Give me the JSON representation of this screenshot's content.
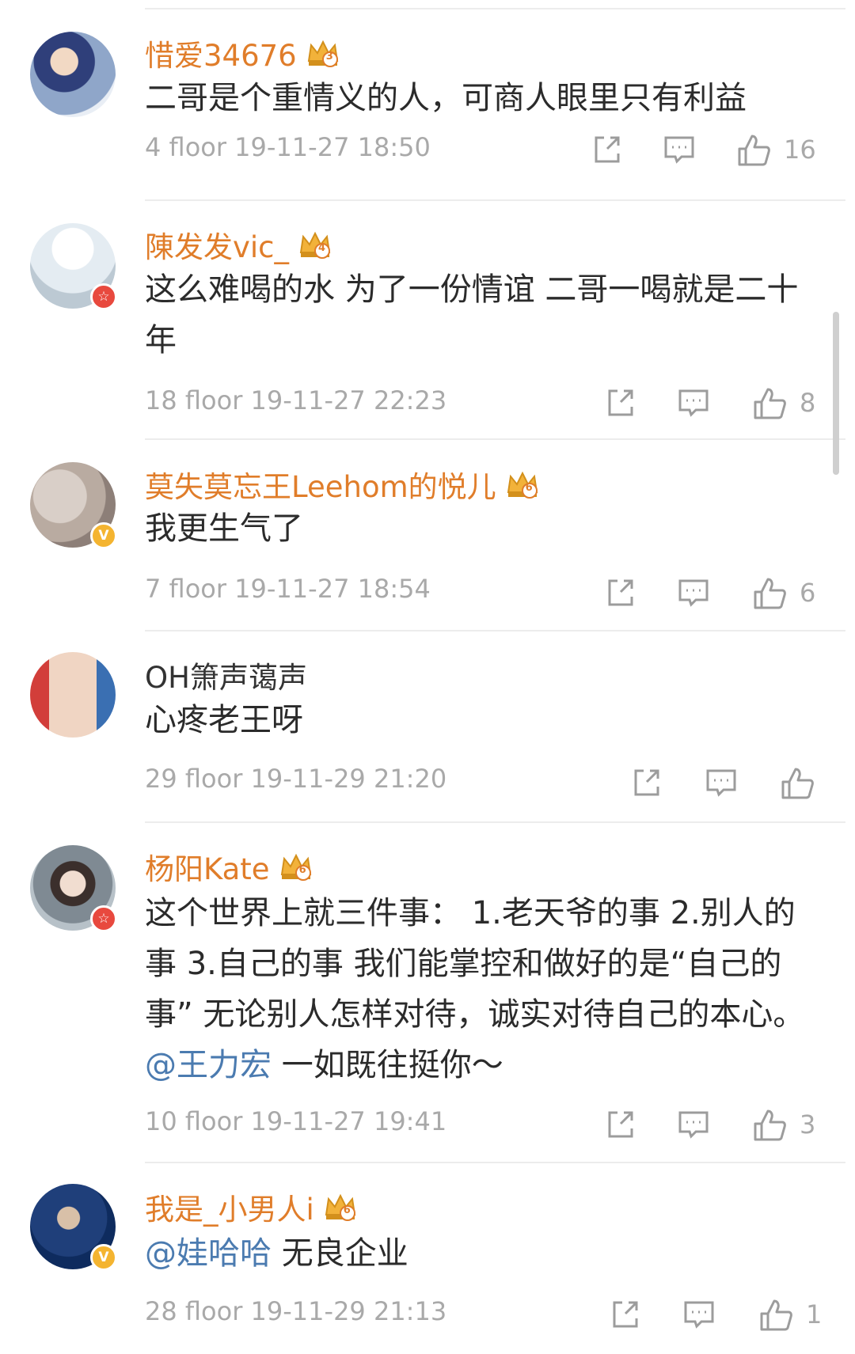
{
  "colors": {
    "username": "#e07d2a",
    "mention": "#4b7bb0",
    "meta": "#a9a9a9",
    "badge_red": "#e8493e",
    "badge_gold": "#f4b430"
  },
  "comments": [
    {
      "username": "惜爱34676",
      "crown_level": "3",
      "text": "二哥是个重情义的人，可商人眼里只有利益",
      "floor": "4 floor",
      "time": "19-11-27 18:50",
      "likes": "16",
      "badge": ""
    },
    {
      "username": "陳发发vic_",
      "crown_level": "4",
      "text": "这么难喝的水 为了一份情谊 二哥一喝就是二十年",
      "floor": "18 floor",
      "time": "19-11-27 22:23",
      "likes": "8",
      "badge": "red"
    },
    {
      "username": "莫失莫忘王Leehom的悦儿",
      "crown_level": "6",
      "text": "我更生气了",
      "floor": "7 floor",
      "time": "19-11-27 18:54",
      "likes": "6",
      "badge": "gold"
    },
    {
      "username": "OH箫声蔼声",
      "crown_level": "",
      "text": "心疼老王呀",
      "floor": "29 floor",
      "time": "19-11-29 21:20",
      "likes": "",
      "badge": ""
    },
    {
      "username": "杨阳Kate",
      "crown_level": "6",
      "text_before": "这个世界上就三件事： 1.老天爷的事 2.别人的事 3.自己的事 我们能掌控和做好的是“自己的事” 无论别人怎样对待，诚实对待自己的本心。",
      "mention": "@王力宏",
      "text_after": " 一如既往挺你～",
      "floor": "10 floor",
      "time": "19-11-27 19:41",
      "likes": "3",
      "badge": "red"
    },
    {
      "username": "我是_小男人i",
      "crown_level": "6",
      "mention": "@娃哈哈",
      "text_after": " 无良企业",
      "floor": "28 floor",
      "time": "19-11-29 21:13",
      "likes": "1",
      "badge": "gold"
    }
  ]
}
